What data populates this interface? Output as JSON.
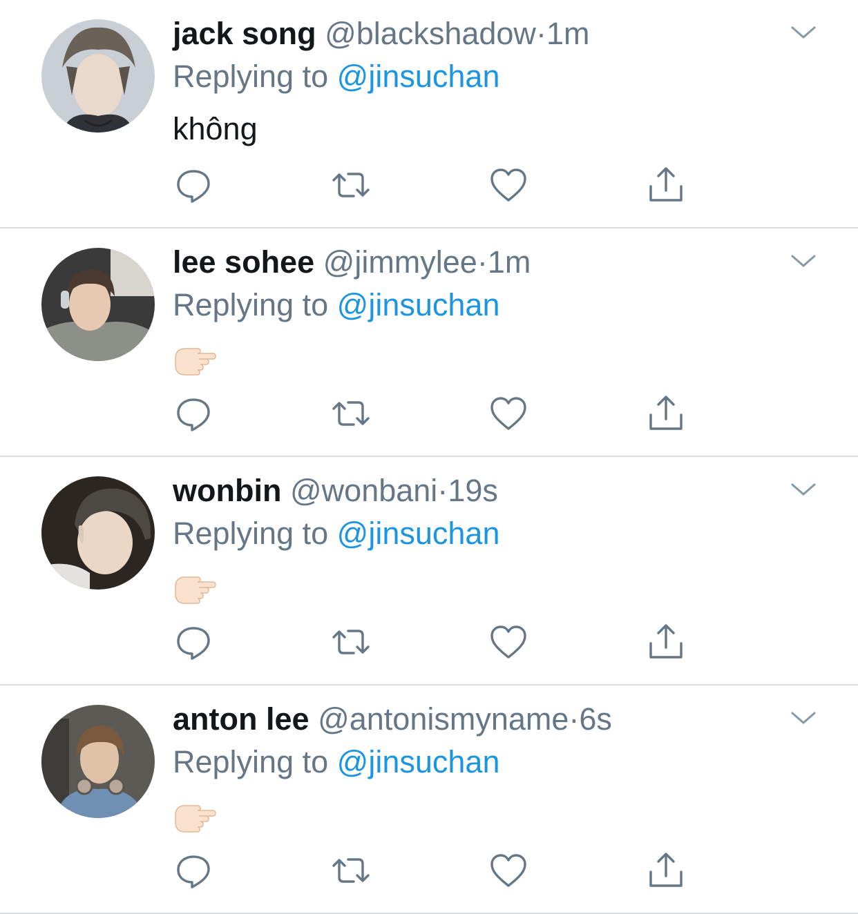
{
  "replies": [
    {
      "display_name": "jack song",
      "handle": "@blackshadow",
      "separator": "·",
      "time": "1m",
      "replying_prefix": "Replying to",
      "replying_to": "@jinsuchan",
      "text": "không",
      "emoji": "",
      "avatar_icon": "avatar-photo"
    },
    {
      "display_name": "lee sohee",
      "handle": "@jimmylee",
      "separator": "·",
      "time": "1m",
      "replying_prefix": "Replying to",
      "replying_to": "@jinsuchan",
      "text": "",
      "emoji": "👉🏻",
      "avatar_icon": "avatar-photo"
    },
    {
      "display_name": "wonbin",
      "handle": "@wonbani",
      "separator": "·",
      "time": "19s",
      "replying_prefix": "Replying to",
      "replying_to": "@jinsuchan",
      "text": "",
      "emoji": "👉🏻",
      "avatar_icon": "avatar-photo"
    },
    {
      "display_name": "anton lee",
      "handle": "@antonismyname",
      "separator": "·",
      "time": "6s",
      "replying_prefix": "Replying to",
      "replying_to": "@jinsuchan",
      "text": "",
      "emoji": "👉🏻",
      "avatar_icon": "avatar-photo"
    }
  ],
  "actions": [
    "reply-icon",
    "retweet-icon",
    "like-icon",
    "share-icon"
  ],
  "colors": {
    "link": "#1b95e0",
    "secondary_text": "#657786",
    "primary_text": "#14171a",
    "divider": "#dcdfe2",
    "icon": "#657786"
  }
}
